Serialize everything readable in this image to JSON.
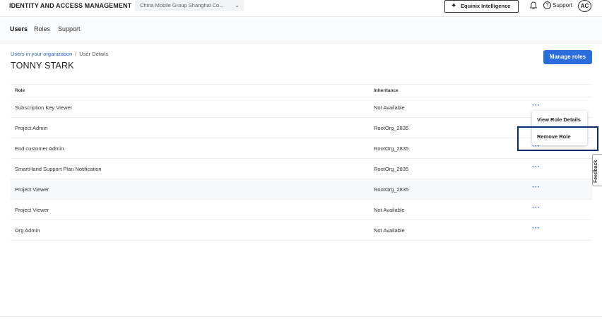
{
  "header": {
    "app_title": "IDENTITY AND ACCESS MANAGEMENT",
    "org_selector": "China Mobile Group Shanghai Co...",
    "ai_button_label": "Equinix Intelligence",
    "support_label": "Support",
    "avatar_initials": "AC"
  },
  "tabs": [
    {
      "label": "Users",
      "active": true
    },
    {
      "label": "Roles",
      "active": false
    },
    {
      "label": "Support",
      "active": false
    }
  ],
  "breadcrumb": {
    "parent": "Users in your organization",
    "separator": "/",
    "current": "User Details"
  },
  "page": {
    "title": "TONNY STARK",
    "manage_roles_label": "Manage roles"
  },
  "table": {
    "headers": {
      "role": "Role",
      "inheritance": "Inheritance"
    },
    "rows": [
      {
        "role": "Subscription Key Viewer",
        "inheritance": "Not Available"
      },
      {
        "role": "Project Admin",
        "inheritance": "RootOrg_2835"
      },
      {
        "role": "End customer Admin",
        "inheritance": "RootOrg_2835"
      },
      {
        "role": "SmartHand Support Plan Notification",
        "inheritance": "RootOrg_2835"
      },
      {
        "role": "Project Viewer",
        "inheritance": "RootOrg_2835"
      },
      {
        "role": "Project Viewer",
        "inheritance": "Not Available"
      },
      {
        "role": "Org Admin",
        "inheritance": "Not Available"
      }
    ],
    "row_menu_glyph": "···"
  },
  "context_menu": {
    "items": [
      {
        "label": "View Role Details"
      },
      {
        "label": "Remove Role"
      }
    ]
  },
  "feedback_label": "Feedback",
  "colors": {
    "primary": "#2a6ddb",
    "link": "#2a66c8",
    "highlight_box": "#0b2a6b"
  }
}
